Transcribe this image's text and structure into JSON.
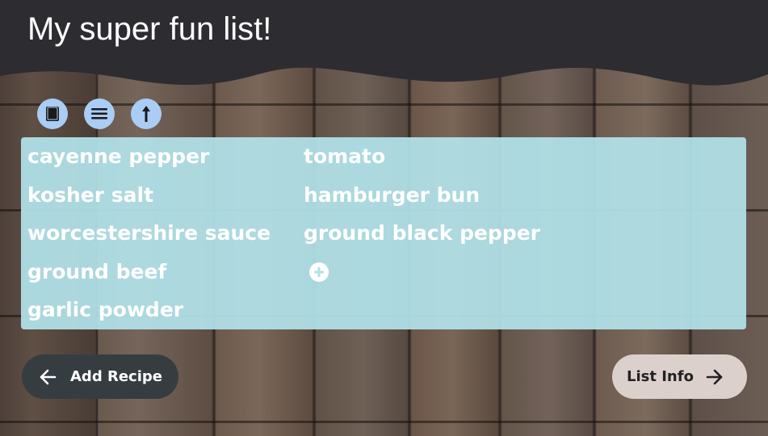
{
  "header": {
    "title": "My super fun list!"
  },
  "toolbar": {
    "icons": [
      "book-icon",
      "list-icon",
      "arrow-up-icon"
    ]
  },
  "list": {
    "column1": [
      "cayenne pepper",
      "kosher salt",
      "worcestershire sauce",
      "ground beef",
      "garlic powder"
    ],
    "column2": [
      "tomato",
      "hamburger bun",
      "ground black pepper"
    ]
  },
  "buttons": {
    "add_recipe": "Add Recipe",
    "list_info": "List Info"
  },
  "colors": {
    "header_bg": "#2d2c31",
    "panel_bg": "#b0e0e8",
    "icon_button_bg": "#a9cdf4",
    "add_recipe_bg": "#363d41",
    "list_info_bg": "#dcd0cd"
  }
}
